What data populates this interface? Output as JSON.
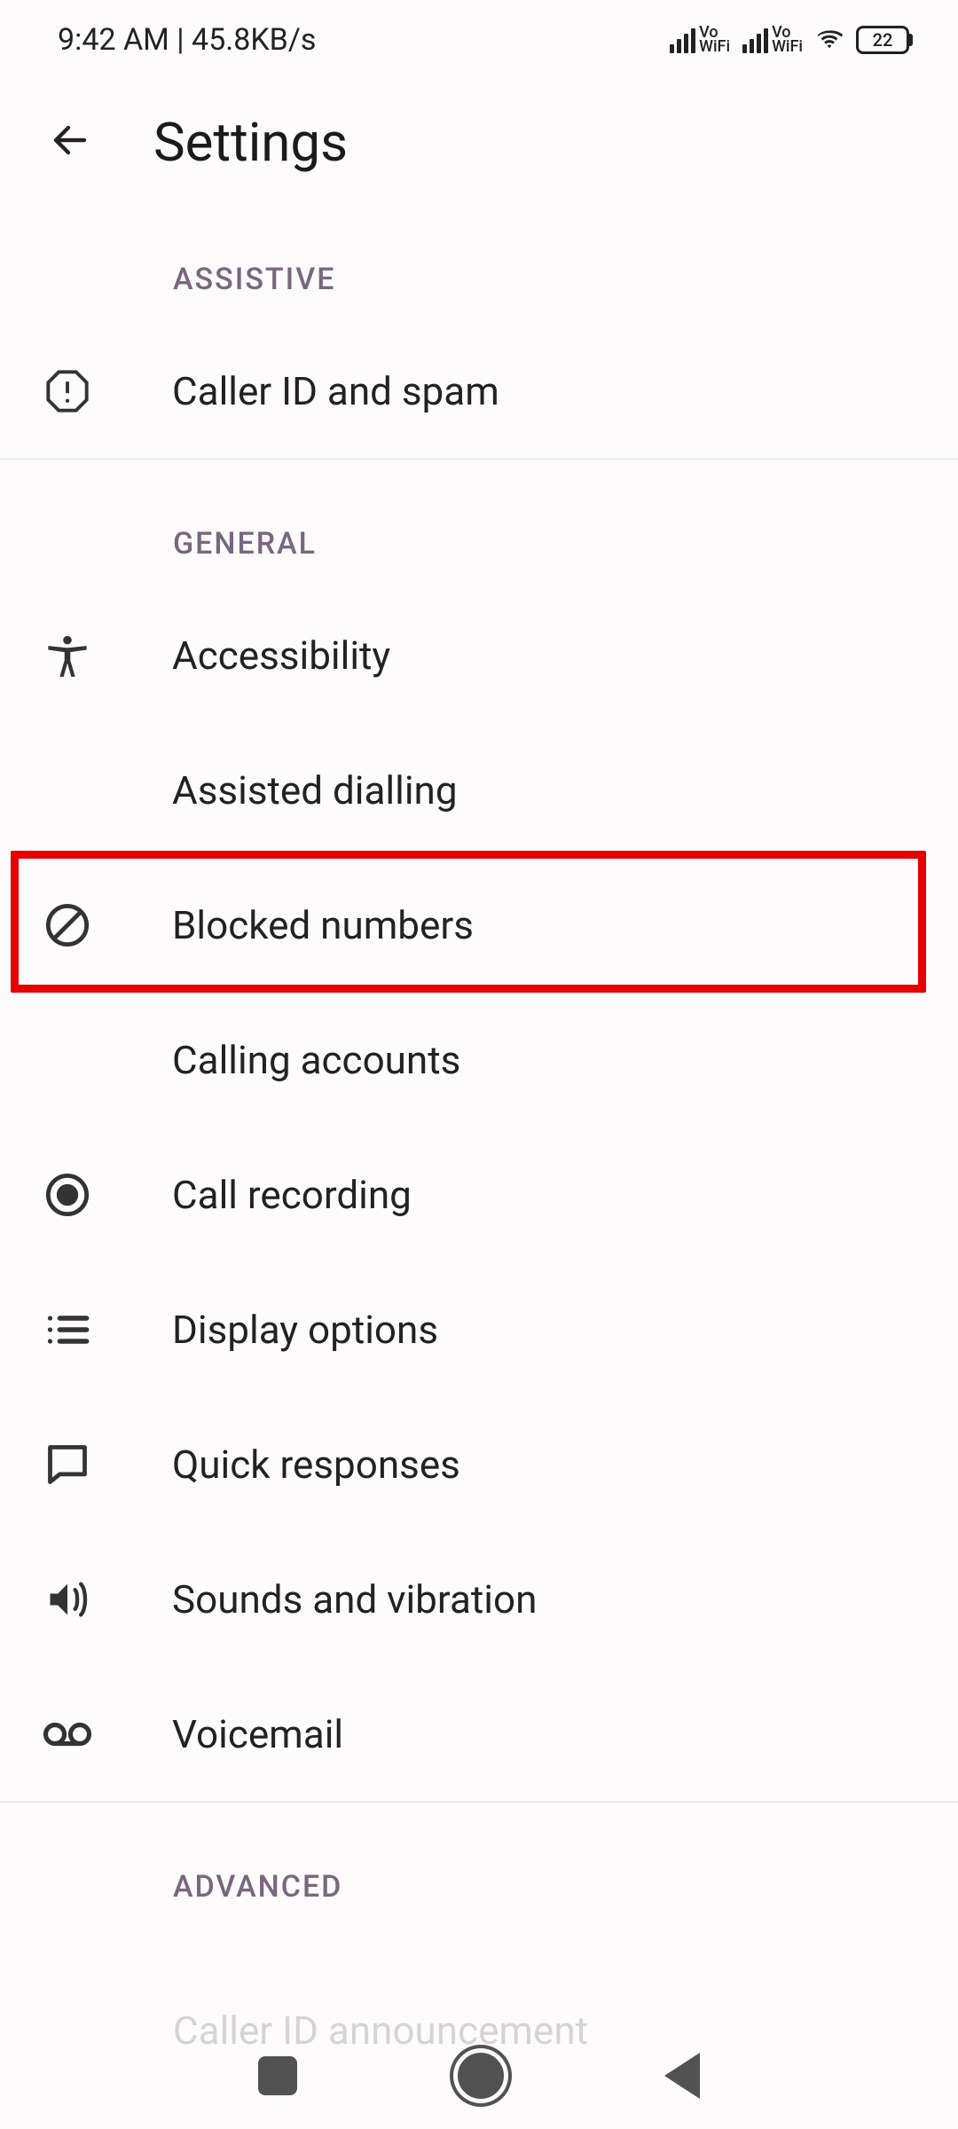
{
  "status": {
    "time_net": "9:42 AM | 45.8KB/s",
    "vowifi": "Vo\nWiFi",
    "battery_pct": "22"
  },
  "header": {
    "title": "Settings"
  },
  "sections": {
    "assistive": {
      "label": "ASSISTIVE",
      "items": {
        "caller_id_spam": "Caller ID and spam"
      }
    },
    "general": {
      "label": "GENERAL",
      "items": {
        "accessibility": "Accessibility",
        "assisted_dialling": "Assisted dialling",
        "blocked_numbers": "Blocked numbers",
        "calling_accounts": "Calling accounts",
        "call_recording": "Call recording",
        "display_options": "Display options",
        "quick_responses": "Quick responses",
        "sounds_vibration": "Sounds and vibration",
        "voicemail": "Voicemail"
      }
    },
    "advanced": {
      "label": "ADVANCED",
      "items": {
        "caller_id_announcement": "Caller ID announcement"
      }
    }
  },
  "annotation": {
    "highlighted_item": "blocked_numbers",
    "highlight_color": "#e60000"
  }
}
